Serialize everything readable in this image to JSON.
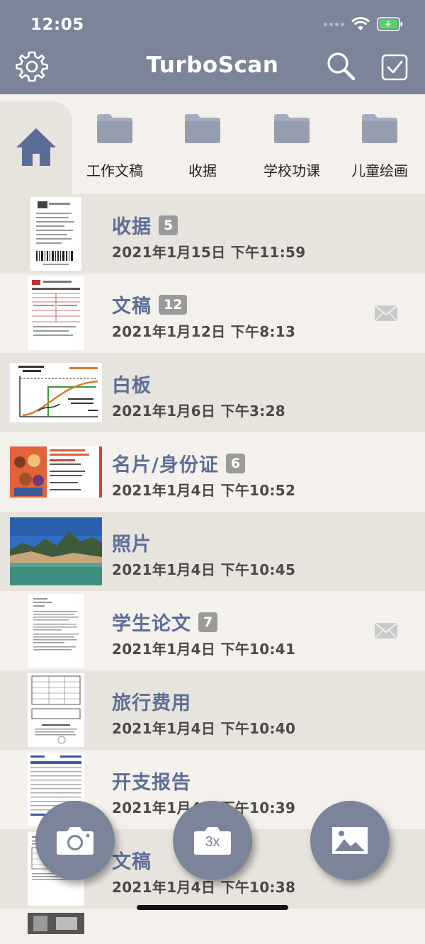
{
  "status": {
    "time": "12:05"
  },
  "header": {
    "title": "TurboScan"
  },
  "folders": [
    {
      "label": "工作文稿"
    },
    {
      "label": "收据"
    },
    {
      "label": "学校功课"
    },
    {
      "label": "儿童绘画"
    }
  ],
  "documents": [
    {
      "name": "收据",
      "count": "5",
      "date": "2021年1月15日 下午11:59",
      "emailed": false
    },
    {
      "name": "文稿",
      "count": "12",
      "date": "2021年1月12日 下午8:13",
      "emailed": true
    },
    {
      "name": "白板",
      "count": "",
      "date": "2021年1月6日 下午3:28",
      "emailed": false
    },
    {
      "name": "名片/身份证",
      "count": "6",
      "date": "2021年1月4日 下午10:52",
      "emailed": false
    },
    {
      "name": "照片",
      "count": "",
      "date": "2021年1月4日 下午10:45",
      "emailed": false
    },
    {
      "name": "学生论文",
      "count": "7",
      "date": "2021年1月4日 下午10:41",
      "emailed": true
    },
    {
      "name": "旅行费用",
      "count": "",
      "date": "2021年1月4日 下午10:40",
      "emailed": false
    },
    {
      "name": "开支报告",
      "count": "",
      "date": "2021年1月4日 下午10:39",
      "emailed": false
    },
    {
      "name": "文稿",
      "count": "",
      "date": "2021年1月4日 下午10:38",
      "emailed": false
    }
  ],
  "actions": {
    "multi_label": "3x"
  },
  "colors": {
    "bar": "#7a8599",
    "accent_text": "#5c6f98",
    "row_alt": "#e7e3dd",
    "row_base": "#f4f1ec"
  }
}
